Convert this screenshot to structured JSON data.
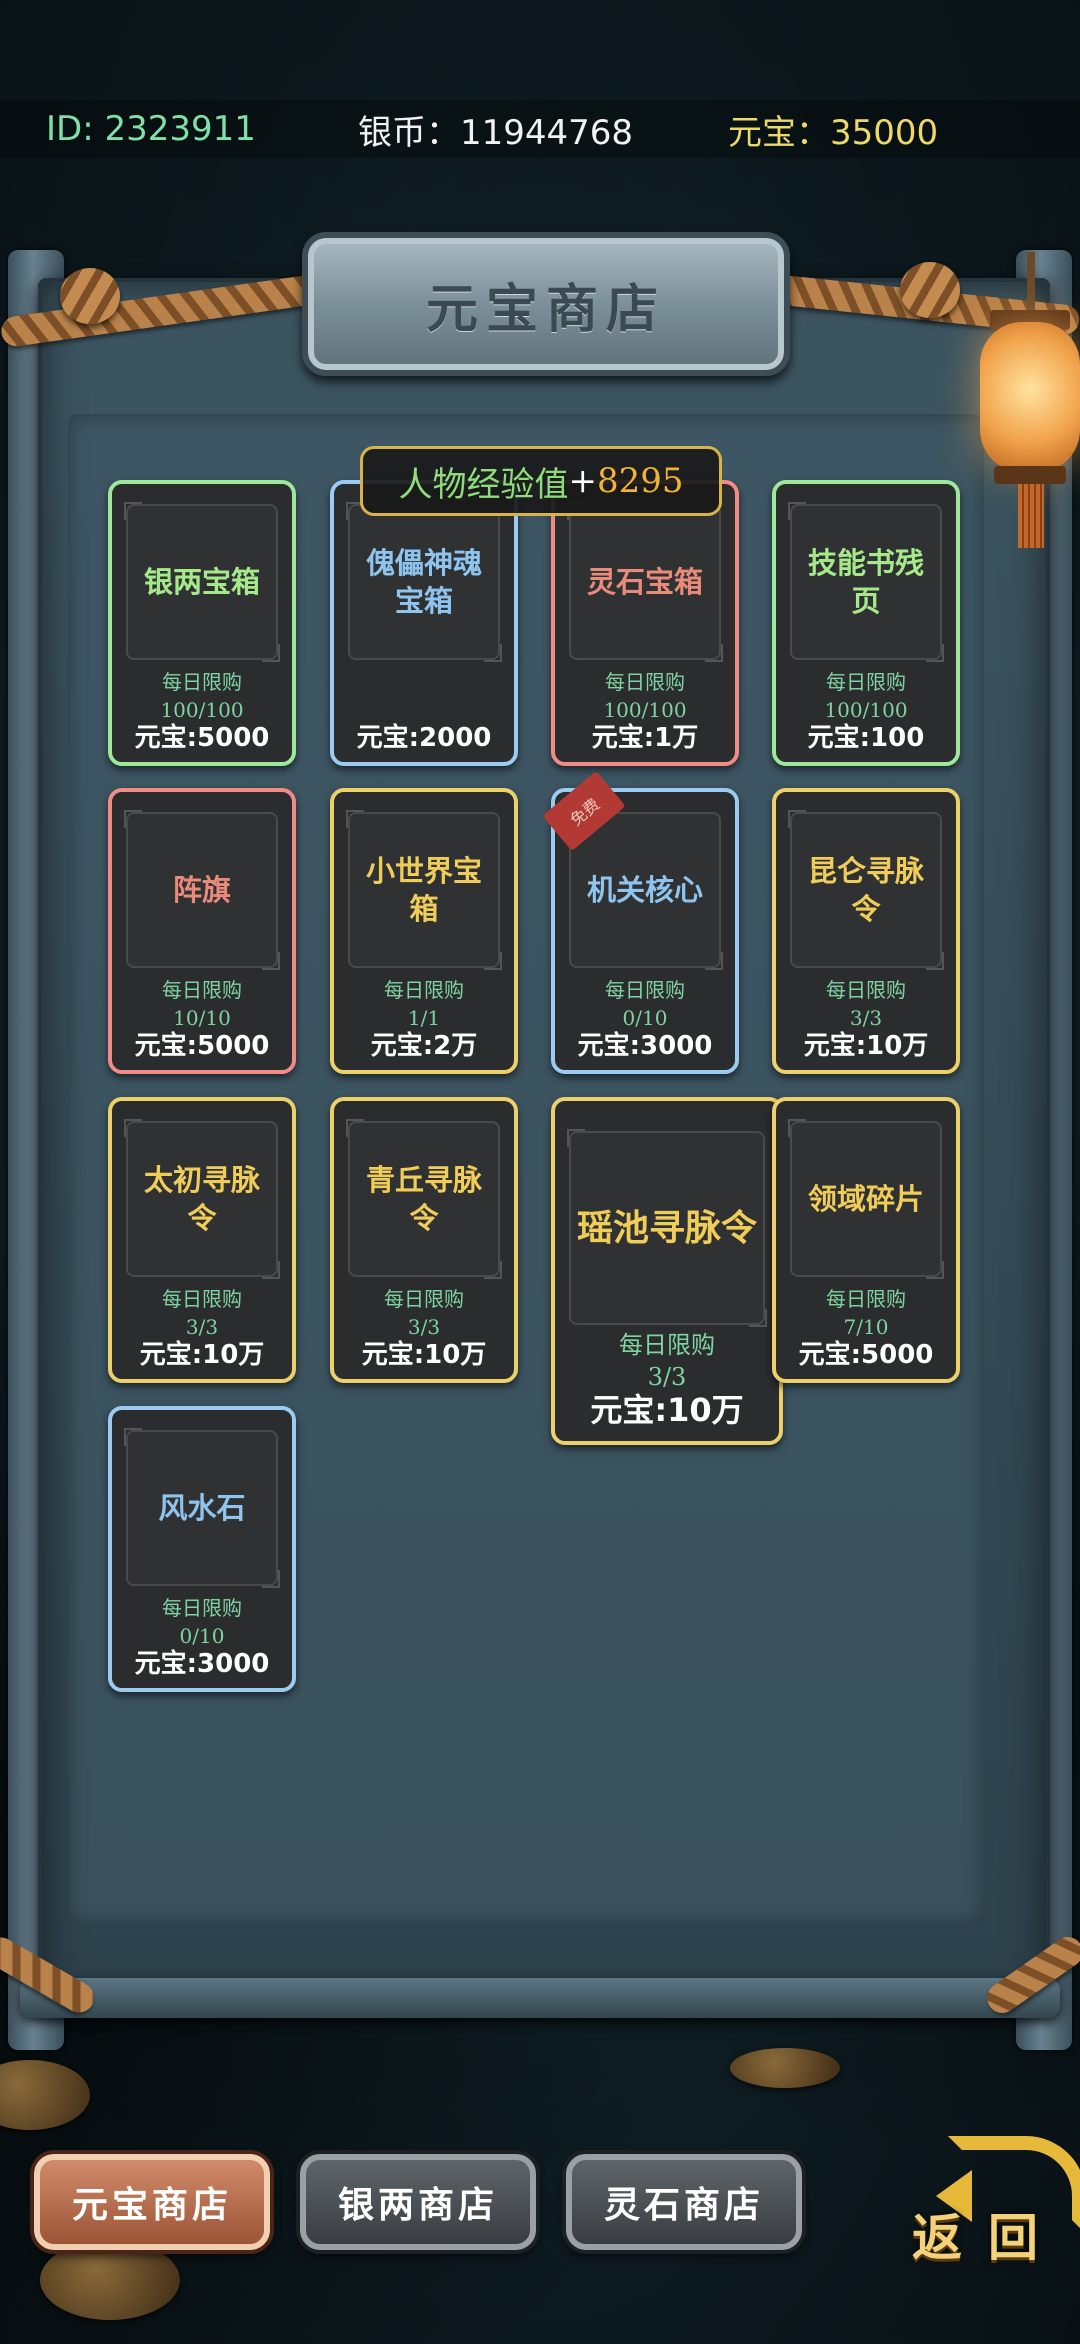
{
  "status_bar": {
    "id_text": "ID: 2323911",
    "silver_text": "银币：11944768",
    "yuanbao_text": "元宝：35000"
  },
  "shop_title": "元宝商店",
  "exp_banner": {
    "label": "人物经验值",
    "plus": "+",
    "value": "8295"
  },
  "colors": {
    "green": "#8be28e",
    "blue": "#8fc4ee",
    "red": "#e8837c",
    "gold": "#e6c66a"
  },
  "items": [
    {
      "name": "银两宝箱",
      "limit_label": "每日限购",
      "limit": "100/100",
      "price": "元宝:5000",
      "rarity": "green"
    },
    {
      "name": "傀儡神魂宝箱",
      "limit_label": "",
      "limit": "",
      "price": "元宝:2000",
      "rarity": "blue"
    },
    {
      "name": "灵石宝箱",
      "limit_label": "每日限购",
      "limit": "100/100",
      "price": "元宝:1万",
      "rarity": "red"
    },
    {
      "name": "技能书残页",
      "limit_label": "每日限购",
      "limit": "100/100",
      "price": "元宝:100",
      "rarity": "green"
    },
    {
      "name": "阵旗",
      "limit_label": "每日限购",
      "limit": "10/10",
      "price": "元宝:5000",
      "rarity": "red"
    },
    {
      "name": "小世界宝箱",
      "limit_label": "每日限购",
      "limit": "1/1",
      "price": "元宝:2万",
      "rarity": "gold"
    },
    {
      "name": "机关核心",
      "limit_label": "每日限购",
      "limit": "0/10",
      "price": "元宝:3000",
      "rarity": "blue",
      "ribbon": "免费"
    },
    {
      "name": "昆仑寻脉令",
      "limit_label": "每日限购",
      "limit": "3/3",
      "price": "元宝:10万",
      "rarity": "gold"
    },
    {
      "name": "太初寻脉令",
      "limit_label": "每日限购",
      "limit": "3/3",
      "price": "元宝:10万",
      "rarity": "gold"
    },
    {
      "name": "青丘寻脉令",
      "limit_label": "每日限购",
      "limit": "3/3",
      "price": "元宝:10万",
      "rarity": "gold"
    },
    {
      "name": "瑶池寻脉令",
      "limit_label": "每日限购",
      "limit": "3/3",
      "price": "元宝:10万",
      "rarity": "gold"
    },
    {
      "name": "领域碎片",
      "limit_label": "每日限购",
      "limit": "7/10",
      "price": "元宝:5000",
      "rarity": "gold"
    },
    {
      "name": "风水石",
      "limit_label": "每日限购",
      "limit": "0/10",
      "price": "元宝:3000",
      "rarity": "blue"
    }
  ],
  "tabs": [
    {
      "label": "元宝商店",
      "active": true
    },
    {
      "label": "银两商店",
      "active": false
    },
    {
      "label": "灵石商店",
      "active": false
    }
  ],
  "back_label": "返回"
}
